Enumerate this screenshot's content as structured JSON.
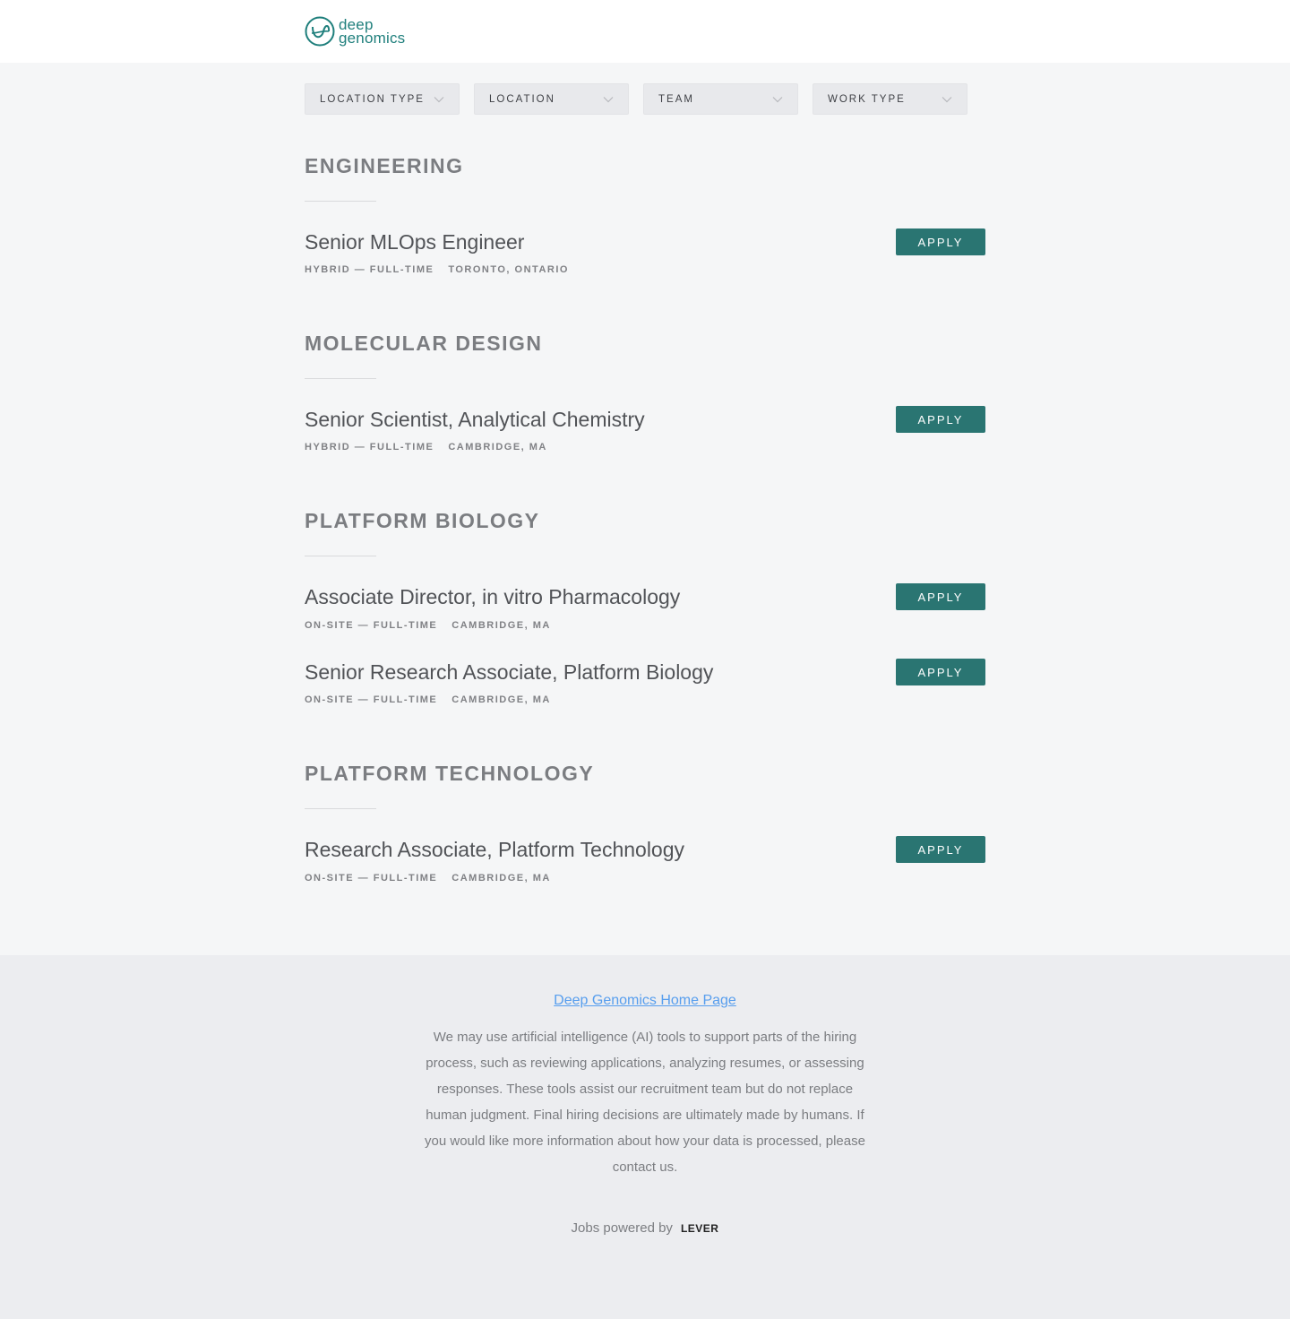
{
  "brand": {
    "logo_line1": "deep",
    "logo_line2": "genomics",
    "accent": "#2a7572"
  },
  "filters": [
    {
      "label": "LOCATION TYPE"
    },
    {
      "label": "LOCATION"
    },
    {
      "label": "TEAM"
    },
    {
      "label": "WORK TYPE"
    }
  ],
  "sections": [
    {
      "title": "ENGINEERING",
      "postings": [
        {
          "title": "Senior MLOps Engineer",
          "type": "HYBRID — FULL-TIME",
          "location": "TORONTO, ONTARIO",
          "apply": "APPLY"
        }
      ]
    },
    {
      "title": "MOLECULAR DESIGN",
      "postings": [
        {
          "title": "Senior Scientist, Analytical Chemistry",
          "type": "HYBRID — FULL-TIME",
          "location": "CAMBRIDGE, MA",
          "apply": "APPLY"
        }
      ]
    },
    {
      "title": "PLATFORM BIOLOGY",
      "postings": [
        {
          "title": "Associate Director, in vitro Pharmacology",
          "type": "ON-SITE — FULL-TIME",
          "location": "CAMBRIDGE, MA",
          "apply": "APPLY"
        },
        {
          "title": "Senior Research Associate, Platform Biology",
          "type": "ON-SITE — FULL-TIME",
          "location": "CAMBRIDGE, MA",
          "apply": "APPLY"
        }
      ]
    },
    {
      "title": "PLATFORM TECHNOLOGY",
      "postings": [
        {
          "title": "Research Associate, Platform Technology",
          "type": "ON-SITE — FULL-TIME",
          "location": "CAMBRIDGE, MA",
          "apply": "APPLY"
        }
      ]
    }
  ],
  "footer": {
    "home_link": "Deep Genomics Home Page",
    "disclaimer": "We may use artificial intelligence (AI) tools to support parts of the hiring process, such as reviewing applications, analyzing resumes, or assessing responses. These tools assist our recruitment team but do not replace human judgment. Final hiring decisions are ultimately made by humans. If you would like more information about how your data is processed, please contact us.",
    "powered_by": "Jobs powered by",
    "lever": "LEVER"
  }
}
